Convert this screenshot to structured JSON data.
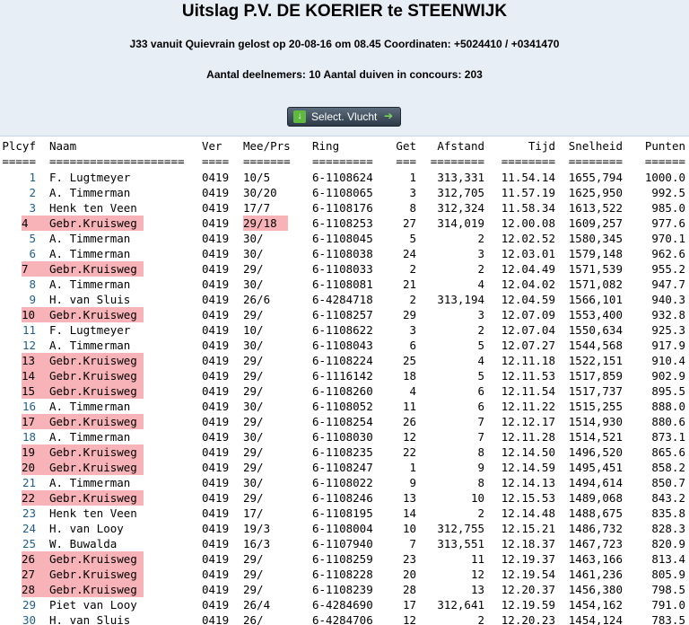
{
  "header": {
    "title": "Uitslag P.V. DE KOERIER te STEENWIJK",
    "flight_info": "J33 vanuit Quievrain gelost op 20-08-16 om 08.45 Coordinaten: +5024410 / +0341470",
    "counts": "Aantal deelnemers: 10 Aantal duiven in concours: 203"
  },
  "toolbar": {
    "select_label": "Select. Vlucht",
    "download_icon": "download-icon",
    "arrow_icon": "arrow-right-icon"
  },
  "colors": {
    "highlight": "#f8b3b8",
    "header_bg": "#e8eef6",
    "place_blue": "#1f5f8a"
  },
  "table": {
    "headers": [
      "Plcyf",
      "Naam",
      "Ver",
      "Mee/Prs",
      "Ring",
      "Get",
      "Afstand",
      "Tijd",
      "Snelheid",
      "Punten"
    ],
    "separators": [
      "=====",
      "====================",
      "====",
      "=======",
      "=========",
      "===",
      "========",
      "========",
      "========",
      "======"
    ],
    "rows": [
      [
        "1",
        "F. Lugtmeyer",
        "0419",
        "10/5",
        "6-1108624",
        "1",
        "313,331",
        "11.54.14",
        "1655,794",
        "1000.0"
      ],
      [
        "2",
        "A. Timmerman",
        "0419",
        "30/20",
        "6-1108065",
        "3",
        "312,705",
        "11.57.19",
        "1625,950",
        "992.5"
      ],
      [
        "3",
        "Henk ten Veen",
        "0419",
        "17/7",
        "6-1108176",
        "8",
        "312,324",
        "11.58.34",
        "1613,522",
        "985.0"
      ],
      [
        "4",
        "Gebr.Kruisweg",
        "0419",
        "29/18",
        "6-1108253",
        "27",
        "314,019",
        "12.00.08",
        "1609,257",
        "977.6"
      ],
      [
        "5",
        "A. Timmerman",
        "0419",
        "30/",
        "6-1108045",
        "5",
        "2",
        "12.02.52",
        "1580,345",
        "970.1"
      ],
      [
        "6",
        "A. Timmerman",
        "0419",
        "30/",
        "6-1108038",
        "24",
        "3",
        "12.03.01",
        "1579,148",
        "962.6"
      ],
      [
        "7",
        "Gebr.Kruisweg",
        "0419",
        "29/",
        "6-1108033",
        "2",
        "2",
        "12.04.49",
        "1571,539",
        "955.2"
      ],
      [
        "8",
        "A. Timmerman",
        "0419",
        "30/",
        "6-1108081",
        "21",
        "4",
        "12.04.02",
        "1571,082",
        "947.7"
      ],
      [
        "9",
        "H. van Sluis",
        "0419",
        "26/6",
        "6-4284718",
        "2",
        "313,194",
        "12.04.59",
        "1566,101",
        "940.3"
      ],
      [
        "10",
        "Gebr.Kruisweg",
        "0419",
        "29/",
        "6-1108257",
        "29",
        "3",
        "12.07.09",
        "1553,400",
        "932.8"
      ],
      [
        "11",
        "F. Lugtmeyer",
        "0419",
        "10/",
        "6-1108622",
        "3",
        "2",
        "12.07.04",
        "1550,634",
        "925.3"
      ],
      [
        "12",
        "A. Timmerman",
        "0419",
        "30/",
        "6-1108043",
        "6",
        "5",
        "12.07.27",
        "1544,568",
        "917.9"
      ],
      [
        "13",
        "Gebr.Kruisweg",
        "0419",
        "29/",
        "6-1108224",
        "25",
        "4",
        "12.11.18",
        "1522,151",
        "910.4"
      ],
      [
        "14",
        "Gebr.Kruisweg",
        "0419",
        "29/",
        "6-1116142",
        "18",
        "5",
        "12.11.53",
        "1517,859",
        "902.9"
      ],
      [
        "15",
        "Gebr.Kruisweg",
        "0419",
        "29/",
        "6-1108260",
        "4",
        "6",
        "12.11.54",
        "1517,737",
        "895.5"
      ],
      [
        "16",
        "A. Timmerman",
        "0419",
        "30/",
        "6-1108052",
        "11",
        "6",
        "12.11.22",
        "1515,255",
        "888.0"
      ],
      [
        "17",
        "Gebr.Kruisweg",
        "0419",
        "29/",
        "6-1108254",
        "26",
        "7",
        "12.12.17",
        "1514,930",
        "880.6"
      ],
      [
        "18",
        "A. Timmerman",
        "0419",
        "30/",
        "6-1108030",
        "12",
        "7",
        "12.11.28",
        "1514,521",
        "873.1"
      ],
      [
        "19",
        "Gebr.Kruisweg",
        "0419",
        "29/",
        "6-1108235",
        "22",
        "8",
        "12.14.50",
        "1496,520",
        "865.6"
      ],
      [
        "20",
        "Gebr.Kruisweg",
        "0419",
        "29/",
        "6-1108247",
        "1",
        "9",
        "12.14.59",
        "1495,451",
        "858.2"
      ],
      [
        "21",
        "A. Timmerman",
        "0419",
        "30/",
        "6-1108022",
        "9",
        "8",
        "12.14.13",
        "1494,614",
        "850.7"
      ],
      [
        "22",
        "Gebr.Kruisweg",
        "0419",
        "29/",
        "6-1108246",
        "13",
        "10",
        "12.15.53",
        "1489,068",
        "843.2"
      ],
      [
        "23",
        "Henk ten Veen",
        "0419",
        "17/",
        "6-1108195",
        "14",
        "2",
        "12.14.48",
        "1488,675",
        "835.8"
      ],
      [
        "24",
        "H. van Looy",
        "0419",
        "19/3",
        "6-1108004",
        "10",
        "312,755",
        "12.15.21",
        "1486,732",
        "828.3"
      ],
      [
        "25",
        "W. Buwalda",
        "0419",
        "16/3",
        "6-1107940",
        "7",
        "313,551",
        "12.18.37",
        "1467,723",
        "820.9"
      ],
      [
        "26",
        "Gebr.Kruisweg",
        "0419",
        "29/",
        "6-1108259",
        "23",
        "11",
        "12.19.37",
        "1463,166",
        "813.4"
      ],
      [
        "27",
        "Gebr.Kruisweg",
        "0419",
        "29/",
        "6-1108228",
        "20",
        "12",
        "12.19.54",
        "1461,236",
        "805.9"
      ],
      [
        "28",
        "Gebr.Kruisweg",
        "0419",
        "29/",
        "6-1108239",
        "28",
        "13",
        "12.20.37",
        "1456,380",
        "798.5"
      ],
      [
        "29",
        "Piet van Looy",
        "0419",
        "26/4",
        "6-4284690",
        "17",
        "312,641",
        "12.19.59",
        "1454,162",
        "791.0"
      ],
      [
        "30",
        "H. van Sluis",
        "0419",
        "26/",
        "6-4284706",
        "12",
        "2",
        "12.20.23",
        "1454,124",
        "783.5"
      ]
    ]
  }
}
